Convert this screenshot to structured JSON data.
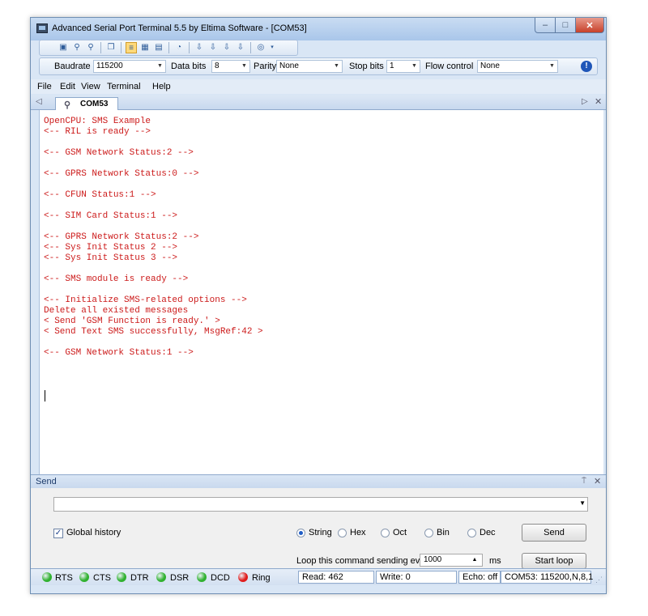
{
  "window": {
    "title": "Advanced Serial Port Terminal 5.5 by Eltima Software - [COM53]",
    "minimize_glyph": "–",
    "maximize_glyph": "□",
    "close_glyph": "✕"
  },
  "settings": {
    "baudrate_label": "Baudrate",
    "baudrate_value": "115200",
    "databits_label": "Data bits",
    "databits_value": "8",
    "parity_label": "Parity",
    "parity_value": "None",
    "stopbits_label": "Stop bits",
    "stopbits_value": "1",
    "flow_label": "Flow control",
    "flow_value": "None",
    "info_glyph": "!"
  },
  "menu": {
    "file": "File",
    "edit": "Edit",
    "view": "View",
    "terminal": "Terminal",
    "help": "Help"
  },
  "tabs": {
    "active_label": "COM53",
    "left_arrow": "◁",
    "right_arrow": "▷",
    "close_glyph": "✕"
  },
  "terminal": {
    "text": "OpenCPU: SMS Example\n<-- RIL is ready -->\n\n<-- GSM Network Status:2 -->\n\n<-- GPRS Network Status:0 -->\n\n<-- CFUN Status:1 -->\n\n<-- SIM Card Status:1 -->\n\n<-- GPRS Network Status:2 -->\n<-- Sys Init Status 2 -->\n<-- Sys Init Status 3 -->\n\n<-- SMS module is ready -->\n\n<-- Initialize SMS-related options -->\nDelete all existed messages\n< Send 'GSM Function is ready.' >\n< Send Text SMS successfully, MsgRef:42 >\n\n<-- GSM Network Status:1 -->",
    "text_color": "#cc1a1a"
  },
  "send_panel": {
    "header": "Send",
    "pin_glyph": "⍑",
    "close_glyph": "✕",
    "input_value": "",
    "global_history_label": "Global history",
    "global_history_checked": true,
    "formats": [
      "String",
      "Hex",
      "Oct",
      "Bin",
      "Dec"
    ],
    "selected_format": "String",
    "send_button": "Send",
    "loop_label": "Loop this command sending every",
    "loop_value": "1000",
    "loop_unit": "ms",
    "start_loop_button": "Start loop"
  },
  "status": {
    "signals": [
      {
        "name": "RTS",
        "color": "#2fb12f"
      },
      {
        "name": "CTS",
        "color": "#2fb12f"
      },
      {
        "name": "DTR",
        "color": "#2fb12f"
      },
      {
        "name": "DSR",
        "color": "#2fb12f"
      },
      {
        "name": "DCD",
        "color": "#2fb12f"
      },
      {
        "name": "Ring",
        "color": "#e01b1b"
      }
    ],
    "read": "Read: 462",
    "write": "Write: 0",
    "echo": "Echo: off",
    "port_info": "COM53: 115200,N,8,1"
  }
}
